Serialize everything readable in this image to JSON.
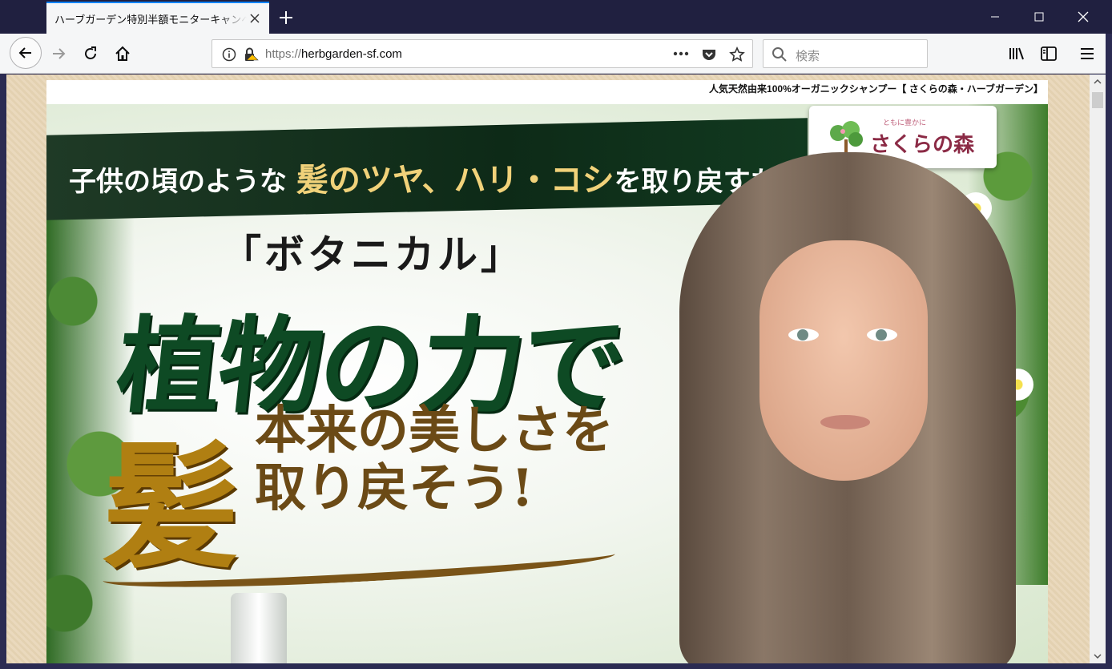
{
  "tab": {
    "title": "ハーブガーデン特別半額モニターキャンペーン"
  },
  "toolbar": {
    "url_prefix": "https://",
    "url_host": "herbgarden-sf.com",
    "search_placeholder": "検索"
  },
  "page": {
    "top_caption": "人気天然由来100%オーガニックシャンプー【 さくらの森・ハーブガーデン】",
    "banner": {
      "pre": "子供の頃のような",
      "highlight": "髪のツヤ、ハリ・コシ",
      "post": "を取り戻すために"
    },
    "logo": {
      "small": "ともに豊かに",
      "name": "さくらの森"
    },
    "botanical": "「ボタニカル」",
    "headline1": "植物の力で",
    "kami": "髪",
    "headline2_line1": "本来の美しさを",
    "headline2_line2": "取り戻そう!"
  },
  "colors": {
    "accent": "#0a84ff",
    "frame": "#202040",
    "headline_green": "#0e4a24",
    "headline_gold": "#b07f12"
  }
}
